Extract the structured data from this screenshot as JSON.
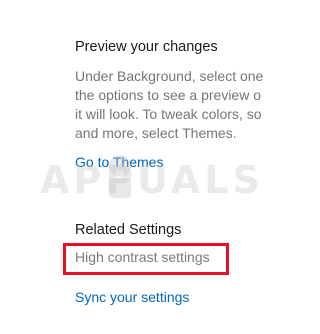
{
  "preview": {
    "heading": "Preview your changes",
    "description_lines": [
      "Under Background, select one",
      "the options to see a preview o",
      "it will look. To tweak colors, so",
      "and more, select Themes."
    ],
    "link": "Go to Themes"
  },
  "related": {
    "heading": "Related Settings",
    "high_contrast_link": "High contrast settings",
    "sync_link": "Sync your settings"
  },
  "watermark": {
    "text": "APPUALS"
  },
  "colors": {
    "link": "#0067b8",
    "highlight": "#e81123",
    "muted_text": "#767676"
  }
}
